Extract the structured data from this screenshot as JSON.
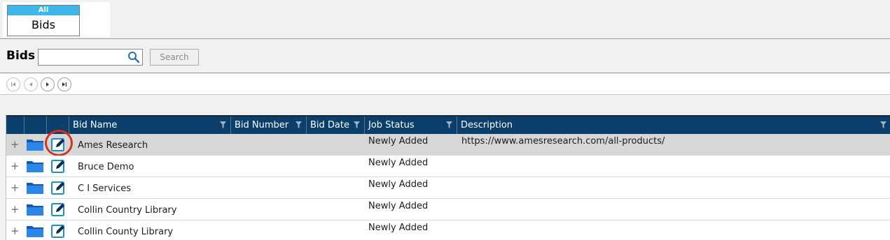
{
  "tabs": [
    {
      "badge": "All",
      "label": "Bids"
    }
  ],
  "search": {
    "title": "Bids",
    "value": "",
    "placeholder": "",
    "button_label": "Search"
  },
  "pager": {
    "buttons": [
      "first-page",
      "previous-page",
      "next-page",
      "last-page"
    ]
  },
  "grid": {
    "columns": [
      "Bid Name",
      "Bid Number",
      "Bid Date",
      "Job Status",
      "Description"
    ],
    "rows": [
      {
        "bid_name": "Ames Research",
        "bid_number": "",
        "bid_date": "",
        "job_status": "Newly Added",
        "description": "https://www.amesresearch.com/all-products/",
        "selected": true
      },
      {
        "bid_name": "Bruce Demo",
        "bid_number": "",
        "bid_date": "",
        "job_status": "Newly Added",
        "description": ""
      },
      {
        "bid_name": "C I Services",
        "bid_number": "",
        "bid_date": "",
        "job_status": "Newly Added",
        "description": ""
      },
      {
        "bid_name": "Collin Country Library",
        "bid_number": "",
        "bid_date": "",
        "job_status": "Newly Added",
        "description": ""
      },
      {
        "bid_name": "Collin County Library",
        "bid_number": "",
        "bid_date": "",
        "job_status": "Newly Added",
        "description": ""
      }
    ],
    "expand_symbol": "+"
  },
  "colors": {
    "header_bg": "#0b3f6b",
    "tab_badge": "#3db6ea",
    "folder": "#1e74d6",
    "edit_icon": "#1b8fcc",
    "highlight": "#d8321f",
    "selected_row": "#d7d7d7"
  },
  "icons": {
    "row_folder": "folder-icon",
    "row_edit": "edit-icon",
    "search": "search-icon",
    "column_filter": "filter-icon"
  }
}
